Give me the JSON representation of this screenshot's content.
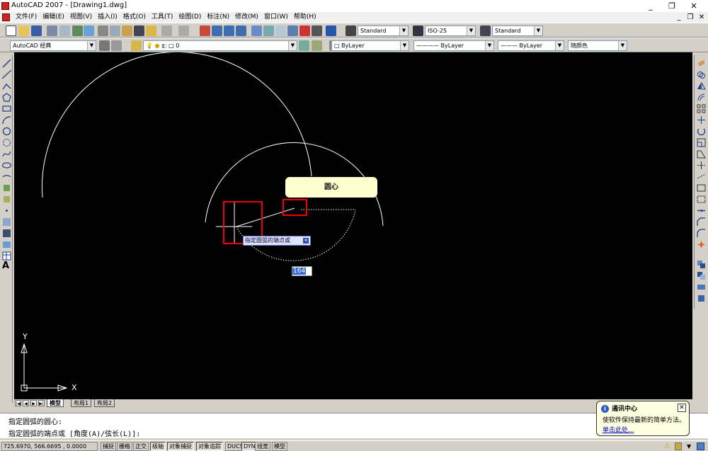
{
  "window": {
    "title": "AutoCAD 2007 - [Drawing1.dwg]",
    "controls": [
      "_",
      "❐",
      "✕"
    ]
  },
  "menubar": {
    "items": [
      "文件(F)",
      "编辑(E)",
      "视图(V)",
      "插入(I)",
      "格式(O)",
      "工具(T)",
      "绘图(D)",
      "标注(N)",
      "修改(M)",
      "窗口(W)",
      "帮助(H)"
    ],
    "mdi_controls": [
      "_",
      "❐",
      "✕"
    ]
  },
  "styles_toolbar": {
    "text_style": "Standard",
    "dim_style": "ISO-25",
    "table_style": "Standard"
  },
  "layers_toolbar": {
    "workspace": "AutoCAD 经典",
    "layer": "0",
    "color": "ByLayer",
    "linetype": "ByLayer",
    "lineweight": "ByLayer",
    "plotstyle": "随颜色"
  },
  "canvas": {
    "tooltip_center": "圆心",
    "prompt_tip": "指定圆弧的端点或",
    "prompt_down": "▾",
    "dyn_value": "164",
    "ucs_x": "X",
    "ucs_y": "Y"
  },
  "tabs": [
    "模型",
    "布局1",
    "布局2"
  ],
  "tab_nav": [
    "|◀",
    "◀",
    "▶",
    "▶|"
  ],
  "command": {
    "line1": "指定圆弧的圆心:",
    "line2": "指定圆弧的端点或 [角度(A)/弦长(L)]:"
  },
  "status": {
    "coords": "725.6970,  566.6695 , 0.0000",
    "buttons": [
      "捕捉",
      "栅格",
      "正交",
      "极轴",
      "对象捕捉",
      "对象追踪",
      "DUCS",
      "DYN",
      "线宽",
      "模型"
    ]
  },
  "balloon": {
    "title": "通讯中心",
    "message": "使软件保持最新的简单方法。",
    "link": "单击此处..."
  },
  "colors": {
    "canvas_bg": "#000000",
    "highlight_red": "#ee0000",
    "tooltip_bg": "#ffffd0"
  }
}
